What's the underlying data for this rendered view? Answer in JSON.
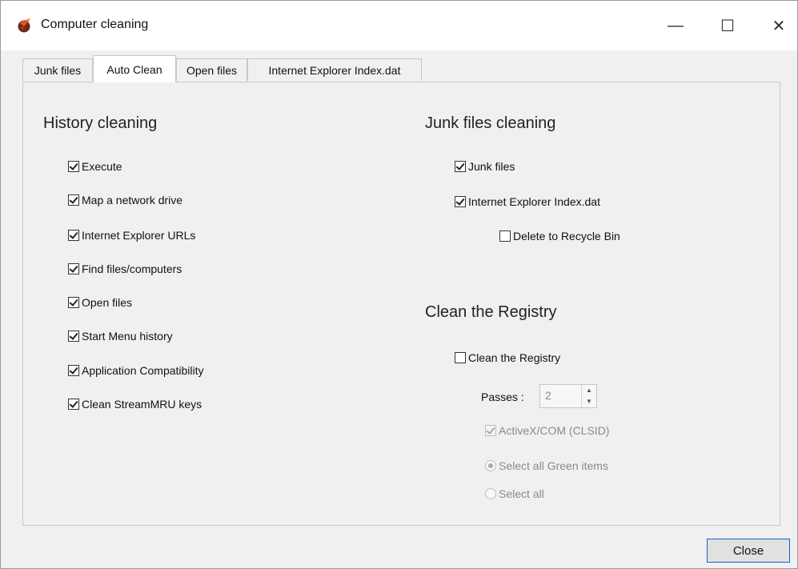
{
  "window": {
    "title": "Computer cleaning",
    "minimize_glyph": "—",
    "maximize_glyph": "☐",
    "close_glyph": "✕"
  },
  "tabs": [
    {
      "label": "Junk files",
      "active": false
    },
    {
      "label": "Auto Clean",
      "active": true
    },
    {
      "label": "Open files",
      "active": false
    },
    {
      "label": "Internet Explorer Index.dat",
      "active": false
    }
  ],
  "history": {
    "title": "History cleaning",
    "items": [
      {
        "label": "Execute",
        "checked": true
      },
      {
        "label": "Map a network drive",
        "checked": true
      },
      {
        "label": "Internet Explorer URLs",
        "checked": true
      },
      {
        "label": "Find files/computers",
        "checked": true
      },
      {
        "label": "Open files",
        "checked": true
      },
      {
        "label": "Start Menu history",
        "checked": true
      },
      {
        "label": "Application Compatibility",
        "checked": true
      },
      {
        "label": "Clean StreamMRU keys",
        "checked": true
      }
    ]
  },
  "junk": {
    "title": "Junk files cleaning",
    "junk_files": {
      "label": "Junk files",
      "checked": true
    },
    "ie_index": {
      "label": "Internet Explorer Index.dat",
      "checked": true
    },
    "recycle": {
      "label": "Delete to Recycle Bin",
      "checked": false
    }
  },
  "registry": {
    "title": "Clean the Registry",
    "clean": {
      "label": "Clean the Registry",
      "checked": false
    },
    "passes_label": "Passes :",
    "passes_value": "2",
    "activex": {
      "label": "ActiveX/COM (CLSID)",
      "checked": true,
      "disabled": true
    },
    "radio_green": {
      "label": "Select all Green items",
      "selected": true,
      "disabled": true
    },
    "radio_all": {
      "label": "Select all",
      "selected": false,
      "disabled": true
    }
  },
  "footer": {
    "close_label": "Close"
  },
  "colors": {
    "accent_border": "#0a64c8",
    "window_bg": "#f0f0f0"
  }
}
